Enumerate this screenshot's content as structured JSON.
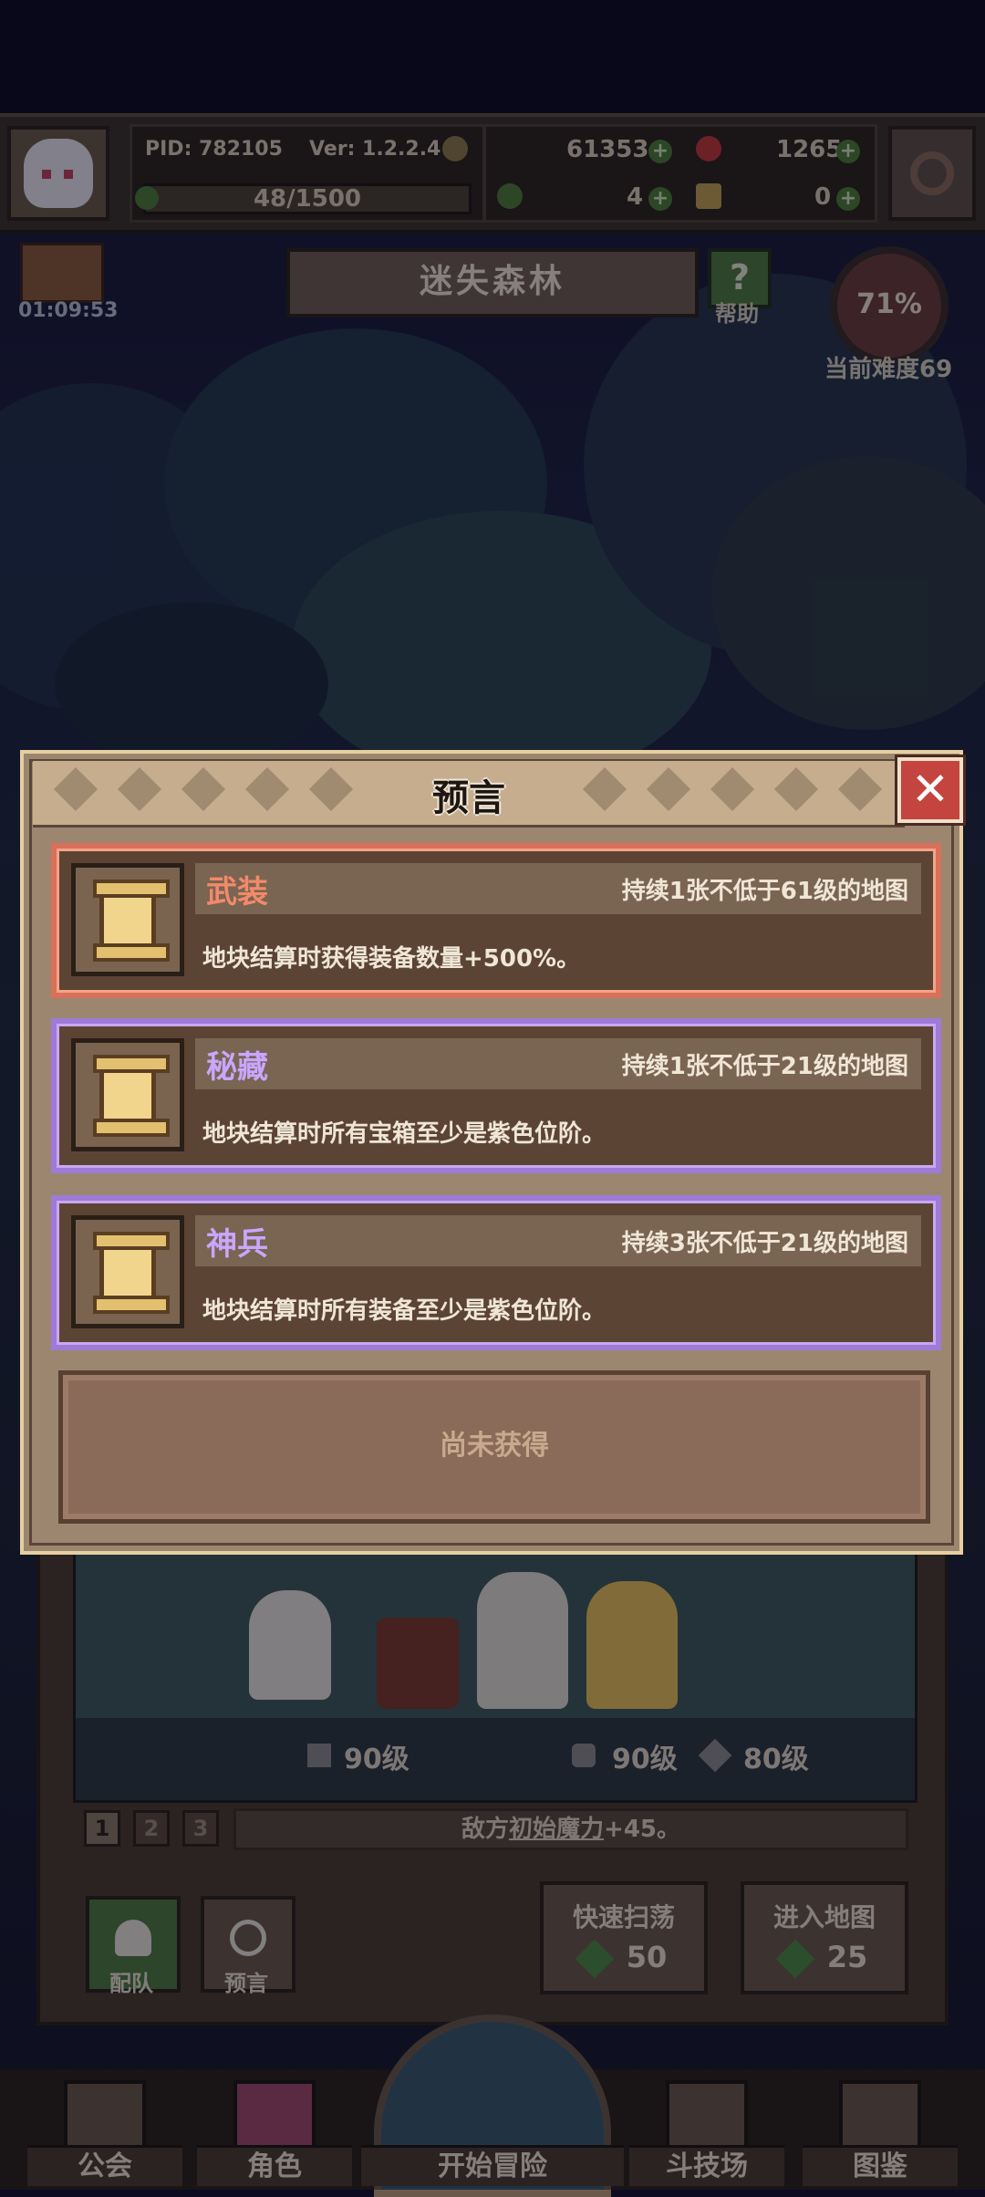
{
  "topbar": {
    "pid": "PID: 782105",
    "version": "Ver: 1.2.2.4",
    "stamina": "48/1500",
    "gold": "61353",
    "gems": "1265",
    "clover": "4",
    "keys": "0"
  },
  "map": {
    "gift_timer": "01:09:53",
    "title": "迷失森林",
    "help_label": "帮助",
    "difficulty_percent": "71%",
    "difficulty_label": "当前难度69"
  },
  "dialog": {
    "title": "预言",
    "cards": [
      {
        "name": "武装",
        "condition": "持续1张不低于61级的地图",
        "description": "地块结算时获得装备数量+500%。",
        "rarity": "red"
      },
      {
        "name": "秘藏",
        "condition": "持续1张不低于21级的地图",
        "description": "地块结算时所有宝箱至少是紫色位阶。",
        "rarity": "purple"
      },
      {
        "name": "神兵",
        "condition": "持续3张不低于21级的地图",
        "description": "地块结算时所有装备至少是紫色位阶。",
        "rarity": "purple"
      }
    ],
    "empty_slot": "尚未获得"
  },
  "stage": {
    "level_a": "90级",
    "level_b": "90级",
    "level_c": "80级",
    "pages": [
      "1",
      "2",
      "3"
    ],
    "buff_prefix": "敌方",
    "buff_keyword": "初始魔力",
    "buff_suffix": "+45。",
    "team_label": "配队",
    "prophecy_label": "预言",
    "sweep_label": "快速扫荡",
    "sweep_cost": "50",
    "enter_label": "进入地图",
    "enter_cost": "25"
  },
  "nav": {
    "guild": "公会",
    "character": "角色",
    "start": "开始冒险",
    "arena": "斗技场",
    "codex": "图鉴"
  },
  "colors": {
    "accent_red": "#d8705a",
    "accent_purple": "#a07ad8",
    "panel_brown": "#5c4434"
  }
}
